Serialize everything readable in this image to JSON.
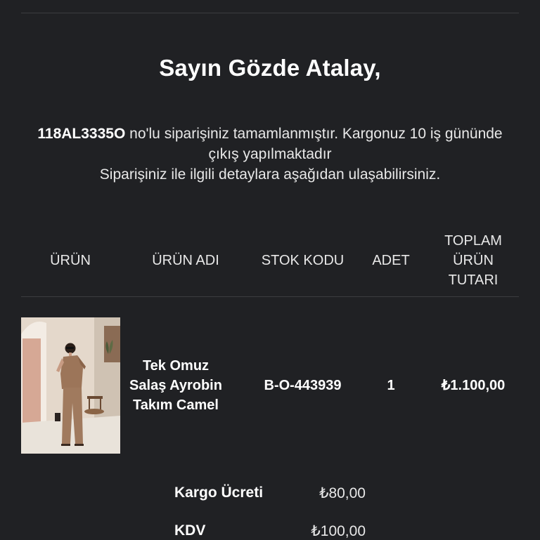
{
  "greeting": "Sayın Gözde Atalay,",
  "message": {
    "order_number": "118AL3335O",
    "line1_rest": " no'lu siparişiniz tamamlanmıştır. Kargonuz 10 iş gününde çıkış yapılmaktadır",
    "line2": "Siparişiniz ile ilgili detaylara aşağıdan ulaşabilirsiniz."
  },
  "table": {
    "headers": {
      "product": "ÜRÜN",
      "product_name": "ÜRÜN ADI",
      "stock_code": "STOK KODU",
      "quantity": "ADET",
      "total": "TOPLAM ÜRÜN TUTARI"
    },
    "rows": [
      {
        "name": "Tek Omuz Salaş Ayrobin Takım Camel",
        "stock_code": "B-O-443939",
        "quantity": "1",
        "total": "₺1.100,00"
      }
    ]
  },
  "summary": {
    "shipping_label": "Kargo Ücreti",
    "shipping_value": "₺80,00",
    "tax_label": "KDV",
    "tax_value": "₺100,00"
  }
}
